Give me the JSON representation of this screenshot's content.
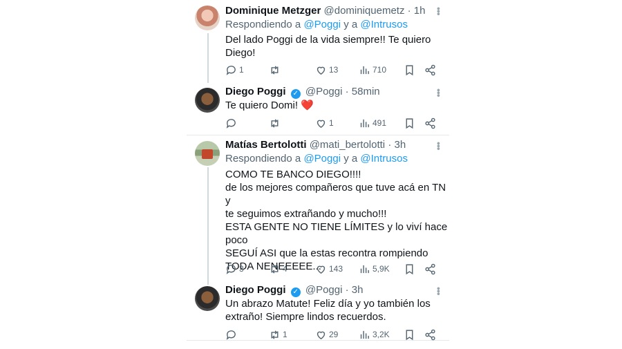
{
  "tweets": [
    {
      "name": "Dominique Metzger",
      "handle": "@dominiquemetz",
      "time": "· 1h",
      "replying_prefix": "Respondiendo a",
      "mention1": "@Poggi",
      "joiner": "y a",
      "mention2": "@Intrusos",
      "text_lines": [
        "Del lado Poggi de la vida siempre!! Te quiero",
        "Diego!"
      ],
      "replies": "1",
      "retweets": "",
      "likes": "13",
      "views": "710"
    },
    {
      "name": "Diego Poggi",
      "handle": "@Poggi",
      "time": "· 58min",
      "text_lines": [
        "Te quiero Domi!"
      ],
      "emoji": "❤️",
      "replies": "",
      "retweets": "",
      "likes": "1",
      "views": "491"
    },
    {
      "name": "Matías Bertolotti",
      "handle": "@mati_bertolotti",
      "time": "· 3h",
      "replying_prefix": "Respondiendo a",
      "mention1": "@Poggi",
      "joiner": "y a",
      "mention2": "@Intrusos",
      "text_lines": [
        "COMO TE BANCO DIEGO!!!!",
        "de los mejores compañeros que tuve acá en TN y",
        "te seguimos extrañando y mucho!!!",
        "ESTA GENTE NO TIENE LÍMITES y lo viví hace",
        "poco",
        "SEGUÍ ASI que la estas recontra rompiendo",
        "TODA NENEEEEE..."
      ],
      "replies": "3",
      "retweets": "4",
      "likes": "143",
      "views": "5,9K"
    },
    {
      "name": "Diego Poggi",
      "handle": "@Poggi",
      "time": "· 3h",
      "text_lines": [
        "Un abrazo Matute! Feliz día y yo también los",
        "extraño! Siempre lindos recuerdos."
      ],
      "replies": "",
      "retweets": "1",
      "likes": "29",
      "views": "3,2K"
    }
  ],
  "icons": {
    "reply": "reply-icon",
    "retweet": "retweet-icon",
    "like": "heart-icon",
    "views": "views-icon",
    "bookmark": "bookmark-icon",
    "share": "share-icon",
    "more": "more-icon",
    "verified": "verified-badge-icon"
  },
  "colors": {
    "link": "#1d9bf0",
    "muted": "#536471",
    "text": "#0f1419",
    "thread_line": "#cfd9de"
  }
}
